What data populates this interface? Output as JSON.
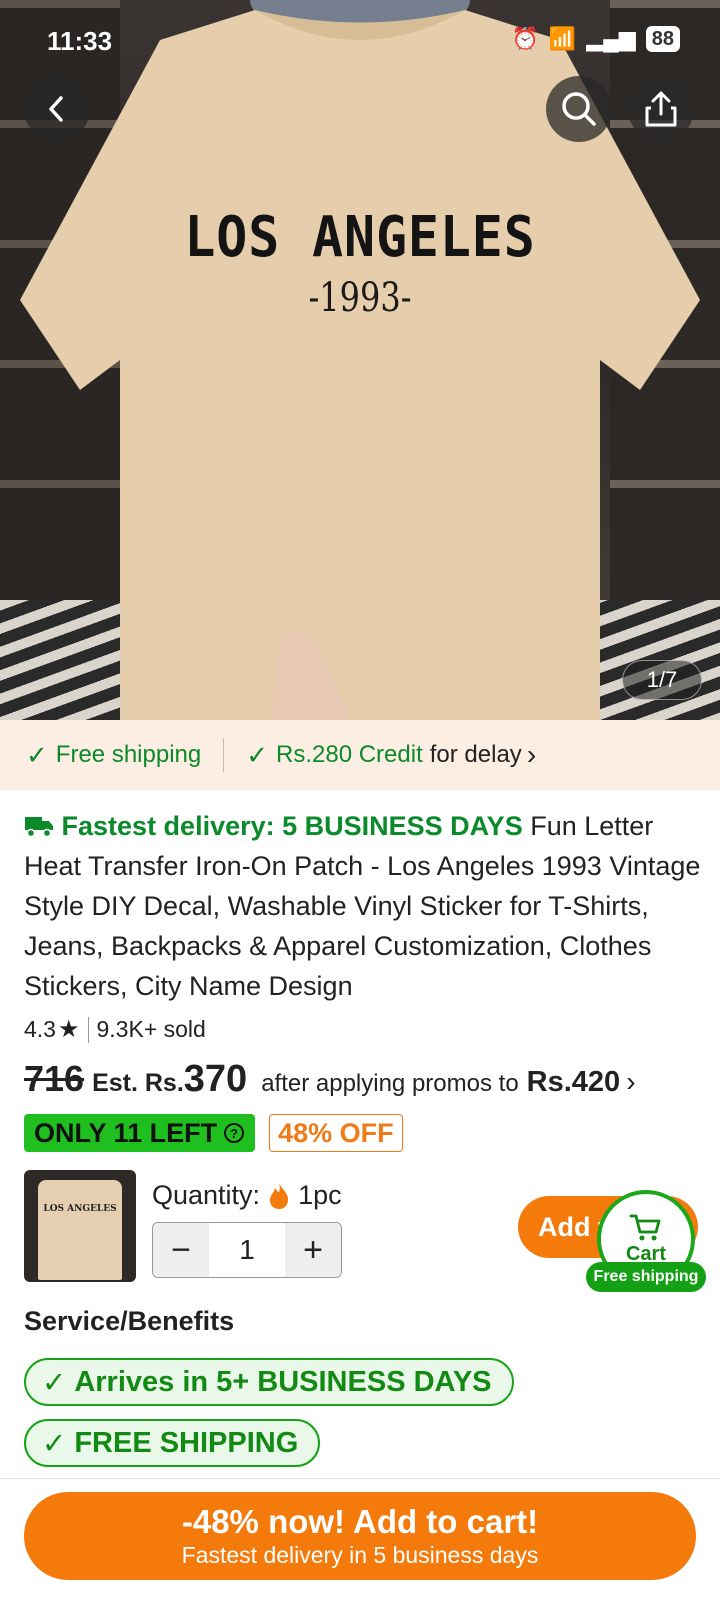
{
  "status_bar": {
    "time": "11:33",
    "battery": "88"
  },
  "hero": {
    "shirt_line1": "LOS ANGELES",
    "shirt_line2": "-1993-",
    "pager": "1/7",
    "icons": {
      "back": "back-arrow-icon",
      "search": "search-icon",
      "share": "share-icon"
    }
  },
  "shipping_banner": {
    "free_shipping": "Free shipping",
    "credit_amount": "Rs.280 Credit",
    "credit_suffix": "for delay",
    "chevron": "›"
  },
  "product": {
    "fast_delivery": "Fastest delivery: 5 BUSINESS DAYS",
    "title": "Fun Letter Heat Transfer Iron-On Patch - Los Angeles 1993 Vintage Style DIY Decal, Washable Vinyl Sticker for T-Shirts, Jeans, Backpacks & Apparel Customization, Clothes Stickers, City Name Design",
    "rating": "4.3",
    "sold": "9.3K+ sold"
  },
  "price": {
    "original": "716",
    "est_label": "Est. Rs.",
    "est_amount": "370",
    "after_text": "after applying promos to",
    "promo_price": "Rs.420",
    "chevron": "›"
  },
  "badges": {
    "stock": "ONLY 11 LEFT",
    "discount": "48% OFF"
  },
  "quantity": {
    "label": "Quantity:",
    "unit": "1pc",
    "value": "1",
    "minus": "−",
    "plus": "+"
  },
  "cart": {
    "add_label": "Add t",
    "cart_label": "Cart",
    "free_shipping": "Free shipping"
  },
  "services": {
    "heading": "Service/Benefits",
    "items": [
      "Arrives in 5+ BUSINESS DAYS",
      "FREE SHIPPING"
    ]
  },
  "cta": {
    "main": "-48% now! Add to cart!",
    "sub": "Fastest delivery in 5 business days"
  },
  "colors": {
    "accent_orange": "#f57a0c",
    "green": "#0a8a2a",
    "banner_bg": "#fdeee3"
  }
}
